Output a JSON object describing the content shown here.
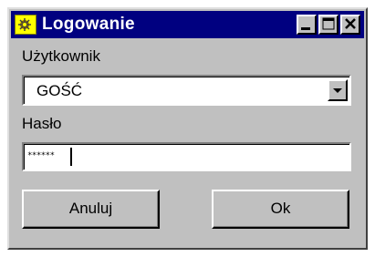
{
  "window": {
    "title": "Logowanie",
    "icon": "app-icon",
    "controls": [
      "minimize-icon",
      "maximize-icon",
      "close-icon"
    ]
  },
  "form": {
    "user_label": "Użytkownik",
    "user_value": "GOŚĆ",
    "password_label": "Hasło",
    "password_value": "******"
  },
  "buttons": {
    "cancel_label": "Anuluj",
    "ok_label": "Ok"
  },
  "colors": {
    "titlebar": "#000080",
    "face": "#c0c0c0",
    "icon_bg": "#ffff00"
  }
}
